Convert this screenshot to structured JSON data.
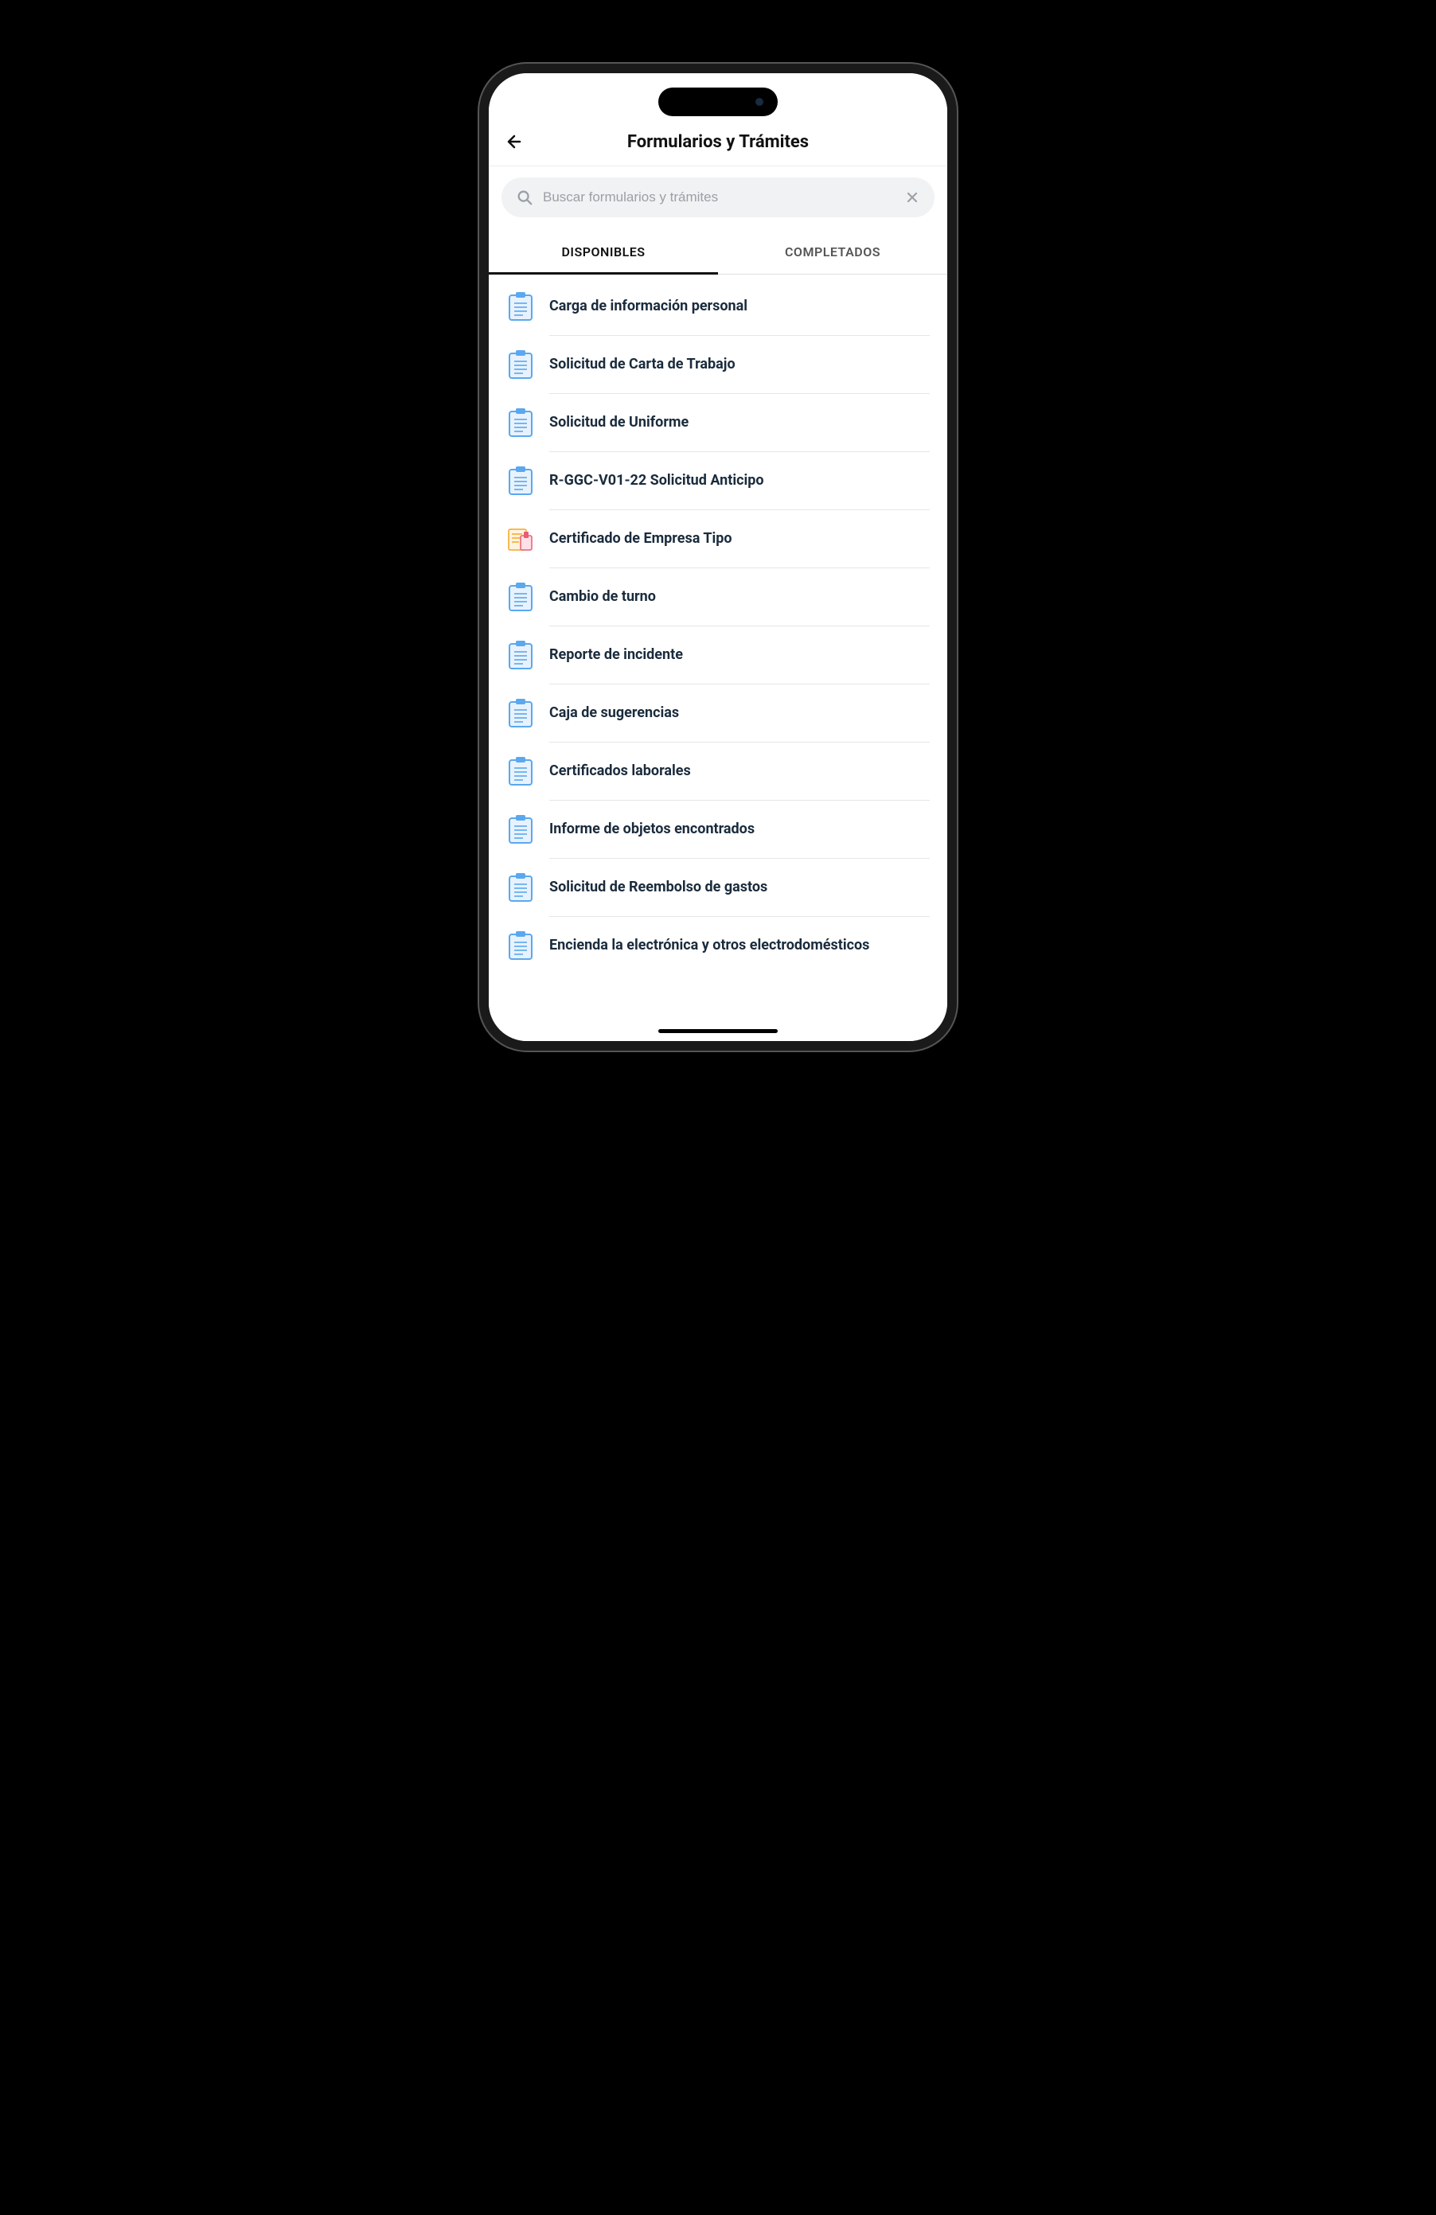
{
  "header": {
    "title": "Formularios y Trámites"
  },
  "search": {
    "placeholder": "Buscar formularios y trámites",
    "value": ""
  },
  "tabs": {
    "available": "DISPONIBLES",
    "completed": "COMPLETADOS",
    "active": "available"
  },
  "list": {
    "items": [
      {
        "label": "Carga de información personal",
        "icon": "clipboard"
      },
      {
        "label": "Solicitud de Carta de Trabajo",
        "icon": "clipboard"
      },
      {
        "label": "Solicitud de Uniforme",
        "icon": "clipboard"
      },
      {
        "label": "R-GGC-V01-22 Solicitud Anticipo",
        "icon": "clipboard"
      },
      {
        "label": "Certificado de  Empresa Tipo",
        "icon": "certificate"
      },
      {
        "label": "Cambio de turno",
        "icon": "clipboard"
      },
      {
        "label": "Reporte de incidente",
        "icon": "clipboard"
      },
      {
        "label": "Caja de sugerencias",
        "icon": "clipboard"
      },
      {
        "label": "Certificados laborales",
        "icon": "clipboard"
      },
      {
        "label": "Informe de objetos encontrados",
        "icon": "clipboard"
      },
      {
        "label": "Solicitud de Reembolso de gastos",
        "icon": "clipboard"
      },
      {
        "label": "Encienda la electrónica y otros electrodomésticos",
        "icon": "clipboard"
      }
    ]
  },
  "icons": {
    "clipboard": {
      "stroke": "#5aa8f0",
      "fill": "#e8f2fd"
    },
    "certificate": {
      "c1": "#f5a623",
      "c2": "#e85d75"
    }
  }
}
